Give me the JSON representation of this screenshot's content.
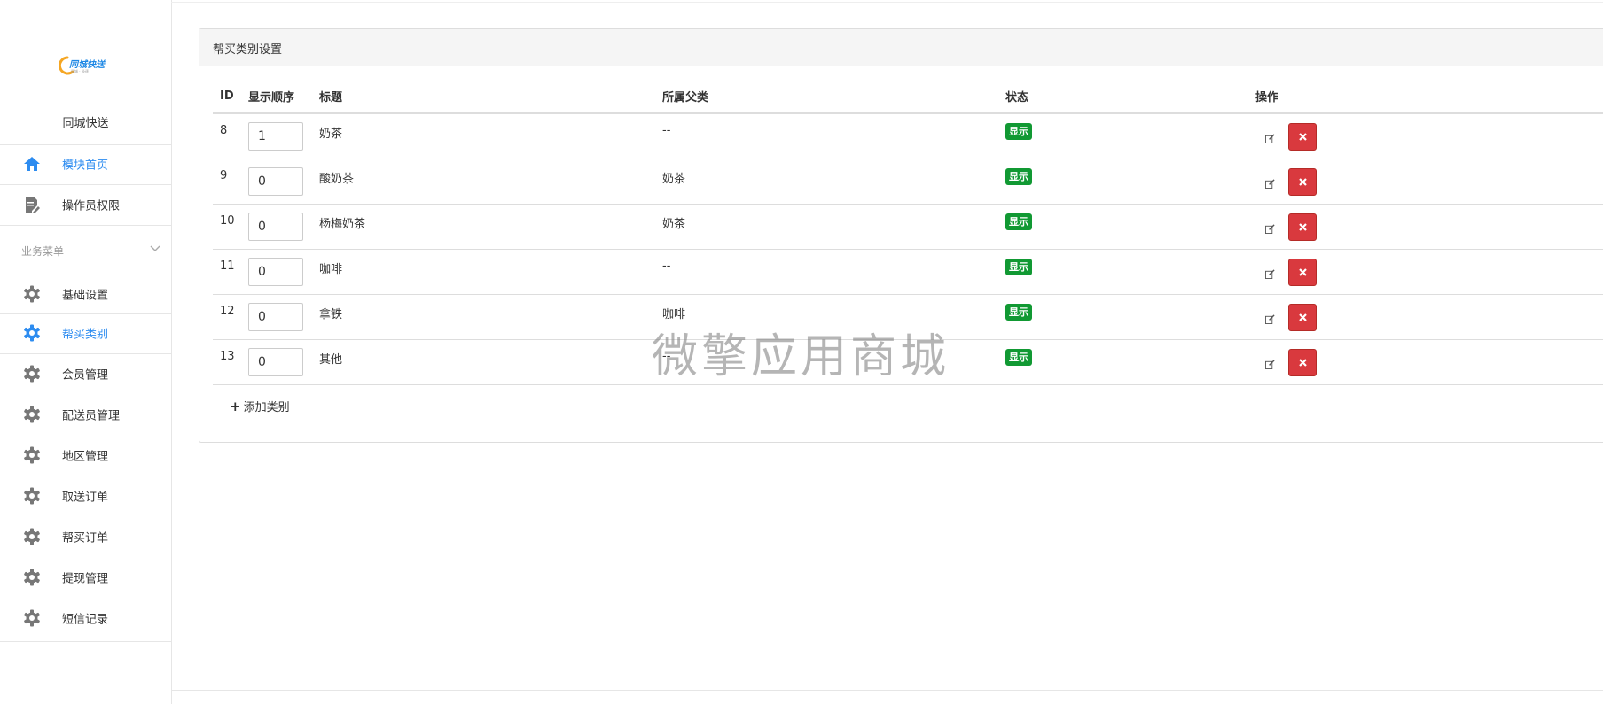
{
  "sidebar": {
    "logo_text": "同城快送",
    "logo_sub": "同城 · 极速",
    "app_name": "同城快送",
    "top_items": [
      {
        "label": "模块首页",
        "icon": "home-icon",
        "active": true
      },
      {
        "label": "操作员权限",
        "icon": "document-edit-icon",
        "active": false
      }
    ],
    "section_label": "业务菜单",
    "items": [
      {
        "label": "基础设置",
        "icon": "gear-icon",
        "active": false
      },
      {
        "label": "帮买类别",
        "icon": "gear-icon",
        "active": true
      },
      {
        "label": "会员管理",
        "icon": "gear-icon",
        "active": false
      },
      {
        "label": "配送员管理",
        "icon": "gear-icon",
        "active": false
      },
      {
        "label": "地区管理",
        "icon": "gear-icon",
        "active": false
      },
      {
        "label": "取送订单",
        "icon": "gear-icon",
        "active": false
      },
      {
        "label": "帮买订单",
        "icon": "gear-icon",
        "active": false
      },
      {
        "label": "提现管理",
        "icon": "gear-icon",
        "active": false
      },
      {
        "label": "短信记录",
        "icon": "gear-icon",
        "active": false
      }
    ]
  },
  "panel": {
    "title": "帮买类别设置",
    "columns": [
      "ID",
      "显示顺序",
      "标题",
      "所属父类",
      "状态",
      "操作"
    ],
    "rows": [
      {
        "id": "8",
        "order": "1",
        "title": "奶茶",
        "parent": "--",
        "status": "显示"
      },
      {
        "id": "9",
        "order": "0",
        "title": "酸奶茶",
        "parent": "奶茶",
        "status": "显示"
      },
      {
        "id": "10",
        "order": "0",
        "title": "杨梅奶茶",
        "parent": "奶茶",
        "status": "显示"
      },
      {
        "id": "11",
        "order": "0",
        "title": "咖啡",
        "parent": "--",
        "status": "显示"
      },
      {
        "id": "12",
        "order": "0",
        "title": "拿铁",
        "parent": "咖啡",
        "status": "显示"
      },
      {
        "id": "13",
        "order": "0",
        "title": "其他",
        "parent": "--",
        "status": "显示"
      }
    ],
    "add_label": "添加类别"
  },
  "watermark": "微擎应用商城",
  "colors": {
    "accent": "#2d8cf0",
    "status_green": "#119933",
    "danger": "#d9393e",
    "icon_gray": "#777777"
  }
}
